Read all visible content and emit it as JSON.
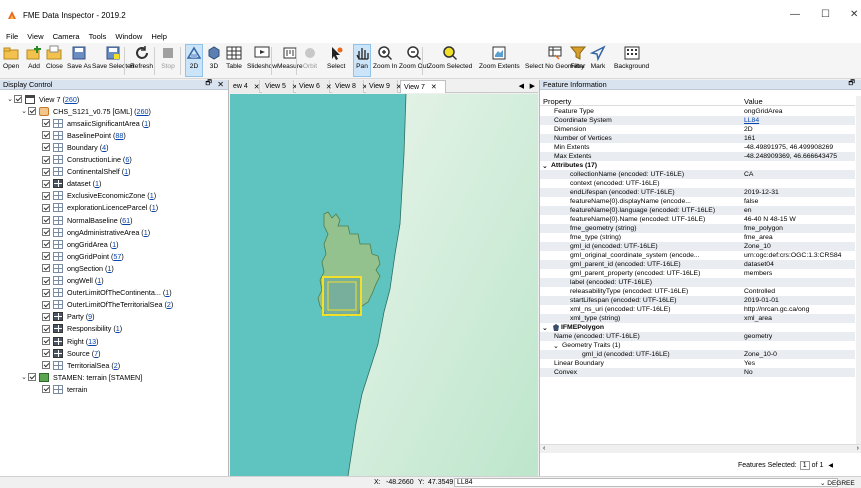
{
  "window": {
    "title": "FME Data Inspector - 2019.2",
    "minimize": "—",
    "maximize": "☐",
    "close": "✕"
  },
  "menu": [
    "File",
    "View",
    "Camera",
    "Tools",
    "Window",
    "Help"
  ],
  "toolbar": [
    {
      "label": "Open",
      "icon": "open-folder-icon",
      "enabled": true
    },
    {
      "label": "Add",
      "icon": "add-icon",
      "enabled": true
    },
    {
      "label": "Close",
      "icon": "close-dataset-icon",
      "enabled": true
    },
    {
      "label": "Save As",
      "icon": "save-as-icon",
      "enabled": true
    },
    {
      "label": "Save Selected",
      "icon": "save-selected-icon",
      "enabled": true
    },
    {
      "label": "Refresh",
      "icon": "refresh-icon",
      "enabled": true
    },
    {
      "label": "Stop",
      "icon": "stop-icon",
      "enabled": false
    },
    {
      "label": "2D",
      "icon": "2d-icon",
      "enabled": true,
      "active": true
    },
    {
      "label": "3D",
      "icon": "3d-icon",
      "enabled": true
    },
    {
      "label": "Table",
      "icon": "table-icon",
      "enabled": true
    },
    {
      "label": "Slideshow",
      "icon": "slideshow-icon",
      "enabled": true
    },
    {
      "label": "Measure",
      "icon": "measure-icon",
      "enabled": true
    },
    {
      "label": "Orbit",
      "icon": "orbit-icon",
      "enabled": false
    },
    {
      "label": "Select",
      "icon": "select-icon",
      "enabled": true
    },
    {
      "label": "Pan",
      "icon": "pan-icon",
      "enabled": true,
      "active": true
    },
    {
      "label": "Zoom In",
      "icon": "zoom-in-icon",
      "enabled": true
    },
    {
      "label": "Zoom Out",
      "icon": "zoom-out-icon",
      "enabled": true
    },
    {
      "label": "Zoom Selected",
      "icon": "zoom-selected-icon",
      "enabled": true
    },
    {
      "label": "Zoom Extents",
      "icon": "zoom-extents-icon",
      "enabled": true
    },
    {
      "label": "Select No Geometry",
      "icon": "select-no-geometry-icon",
      "enabled": true
    },
    {
      "label": "Filter",
      "icon": "filter-icon",
      "enabled": true
    },
    {
      "label": "Mark",
      "icon": "mark-icon",
      "enabled": true
    },
    {
      "label": "Background",
      "icon": "background-icon",
      "enabled": true
    }
  ],
  "display_control": {
    "title": "Display Control",
    "tree": [
      {
        "label": "View 7 ( ",
        "count": "260",
        "suffix": " )",
        "level": 0,
        "icon": "view",
        "expanded": true
      },
      {
        "label": "CHS_S121_v0.75 [GML] ( ",
        "count": "260",
        "suffix": " )",
        "level": 1,
        "icon": "db",
        "expanded": true
      },
      {
        "label": "amsaiicSignificantArea ( ",
        "count": "1",
        "suffix": " )",
        "level": 2,
        "icon": "geom"
      },
      {
        "label": "BaselinePoint ( ",
        "count": "88",
        "suffix": " )",
        "level": 2,
        "icon": "geom"
      },
      {
        "label": "Boundary ( ",
        "count": "4",
        "suffix": " )",
        "level": 2,
        "icon": "geom"
      },
      {
        "label": "ConstructionLine ( ",
        "count": "6",
        "suffix": " )",
        "level": 2,
        "icon": "geom"
      },
      {
        "label": "ContinentalShelf ( ",
        "count": "1",
        "suffix": " )",
        "level": 2,
        "icon": "geom"
      },
      {
        "label": "dataset ( ",
        "count": "1",
        "suffix": " )",
        "level": 2,
        "icon": "tbl"
      },
      {
        "label": "ExclusiveEconomicZone ( ",
        "count": "1",
        "suffix": " )",
        "level": 2,
        "icon": "geom"
      },
      {
        "label": "explorationLicenceParcel ( ",
        "count": "1",
        "suffix": " )",
        "level": 2,
        "icon": "geom"
      },
      {
        "label": "NormalBaseline ( ",
        "count": "61",
        "suffix": " )",
        "level": 2,
        "icon": "geom"
      },
      {
        "label": "ongAdministrativeArea ( ",
        "count": "1",
        "suffix": " )",
        "level": 2,
        "icon": "geom"
      },
      {
        "label": "ongGridArea ( ",
        "count": "1",
        "suffix": " )",
        "level": 2,
        "icon": "geom"
      },
      {
        "label": "ongGridPoint ( ",
        "count": "57",
        "suffix": " )",
        "level": 2,
        "icon": "geom"
      },
      {
        "label": "ongSection ( ",
        "count": "1",
        "suffix": " )",
        "level": 2,
        "icon": "geom"
      },
      {
        "label": "ongWell ( ",
        "count": "1",
        "suffix": " )",
        "level": 2,
        "icon": "geom"
      },
      {
        "label": "OuterLimitOfTheContinenta... ( ",
        "count": "1",
        "suffix": " )",
        "level": 2,
        "icon": "geom"
      },
      {
        "label": "OuterLimitOfTheTerritorialSea ( ",
        "count": "2",
        "suffix": " )",
        "level": 2,
        "icon": "geom"
      },
      {
        "label": "Party ( ",
        "count": "9",
        "suffix": " )",
        "level": 2,
        "icon": "tbl"
      },
      {
        "label": "Responsibility ( ",
        "count": "1",
        "suffix": " )",
        "level": 2,
        "icon": "tbl"
      },
      {
        "label": "Right ( ",
        "count": "13",
        "suffix": " )",
        "level": 2,
        "icon": "tbl"
      },
      {
        "label": "Source ( ",
        "count": "7",
        "suffix": " )",
        "level": 2,
        "icon": "tbl"
      },
      {
        "label": "TerritorialSea ( ",
        "count": "2",
        "suffix": " )",
        "level": 2,
        "icon": "geom"
      },
      {
        "label": "STAMEN: terrain [STAMEN]",
        "count": "",
        "suffix": "",
        "level": 1,
        "icon": "img",
        "expanded": true
      },
      {
        "label": "terrain",
        "count": "",
        "suffix": "",
        "level": 2,
        "icon": "geom"
      }
    ]
  },
  "view_tabs": [
    {
      "label": "ew 4",
      "selected": false
    },
    {
      "label": "View 5",
      "selected": false
    },
    {
      "label": "View 6",
      "selected": false
    },
    {
      "label": "View 8",
      "selected": false
    },
    {
      "label": "View 9",
      "selected": false
    },
    {
      "label": "View 7",
      "selected": true
    }
  ],
  "feature_info": {
    "title": "Feature Information",
    "col_property": "Property",
    "col_value": "Value",
    "rows": [
      {
        "p": "Feature Type",
        "v": "ongGridArea",
        "lvl": 1
      },
      {
        "p": "Coordinate System",
        "v": "LL84",
        "lvl": 1,
        "link": true
      },
      {
        "p": "Dimension",
        "v": "2D",
        "lvl": 1
      },
      {
        "p": "Number of Vertices",
        "v": "161",
        "lvl": 1
      },
      {
        "p": "Min Extents",
        "v": "-48.49891975, 46.499908269",
        "lvl": 1
      },
      {
        "p": "Max Extents",
        "v": "-48.248909369, 46.666643475",
        "lvl": 1
      },
      {
        "p": "Attributes (17)",
        "v": "",
        "lvl": 0,
        "sec": true,
        "arrow": "⌄"
      },
      {
        "p": "collectionName (encoded: UTF-16LE)",
        "v": "CA",
        "lvl": 2
      },
      {
        "p": "context (encoded: UTF-16LE)",
        "v": "",
        "lvl": 2
      },
      {
        "p": "endLifespan (encoded: UTF-16LE)",
        "v": "2019-12-31",
        "lvl": 2
      },
      {
        "p": "featureName{0}.displayName (encode...",
        "v": "false",
        "lvl": 2
      },
      {
        "p": "featureName{0}.language (encoded: UTF-16LE)",
        "v": "en",
        "lvl": 2
      },
      {
        "p": "featureName{0}.Name (encoded: UTF-16LE)",
        "v": "46-40 N 48-15 W",
        "lvl": 2
      },
      {
        "p": "fme_geometry (string)",
        "v": "fme_polygon",
        "lvl": 2
      },
      {
        "p": "fme_type (string)",
        "v": "fme_area",
        "lvl": 2
      },
      {
        "p": "gml_id (encoded: UTF-16LE)",
        "v": "Zone_10",
        "lvl": 2
      },
      {
        "p": "gml_original_coordinate_system (encode...",
        "v": "urn:ogc:def:crs:OGC:1.3:CRS84",
        "lvl": 2
      },
      {
        "p": "gml_parent_id (encoded: UTF-16LE)",
        "v": "dataset04",
        "lvl": 2
      },
      {
        "p": "gml_parent_property (encoded: UTF-16LE)",
        "v": "members",
        "lvl": 2
      },
      {
        "p": "label (encoded: UTF-16LE)",
        "v": "",
        "lvl": 2
      },
      {
        "p": "releasabilityType (encoded: UTF-16LE)",
        "v": "Controlled",
        "lvl": 2
      },
      {
        "p": "startLifespan (encoded: UTF-16LE)",
        "v": "2019-01-01",
        "lvl": 2
      },
      {
        "p": "xml_ns_uri (encoded: UTF-16LE)",
        "v": "http://nrcan.gc.ca/ong",
        "lvl": 2
      },
      {
        "p": "xml_type (string)",
        "v": "xml_area",
        "lvl": 2
      },
      {
        "p": "IFMEPolygon",
        "v": "",
        "lvl": 0,
        "sec": true,
        "arrow": "⌄",
        "poly": true
      },
      {
        "p": "Name (encoded: UTF-16LE)",
        "v": "geometry",
        "lvl": 1
      },
      {
        "p": "Geometry Traits (1)",
        "v": "",
        "lvl": 1,
        "arrow": "⌄"
      },
      {
        "p": "gml_id (encoded: UTF-16LE)",
        "v": "Zone_10-0",
        "lvl": 3
      },
      {
        "p": "Linear Boundary",
        "v": "Yes",
        "lvl": 1
      },
      {
        "p": "Convex",
        "v": "No",
        "lvl": 1
      }
    ],
    "features_selected_label": "Features Selected:",
    "selected_value": "1",
    "of_label": "of 1"
  },
  "status": {
    "x_label": "X:",
    "x": "-48.2660",
    "y_label": "Y:",
    "y": "47.3549",
    "crs": "LL84",
    "units": "DEGREE"
  }
}
